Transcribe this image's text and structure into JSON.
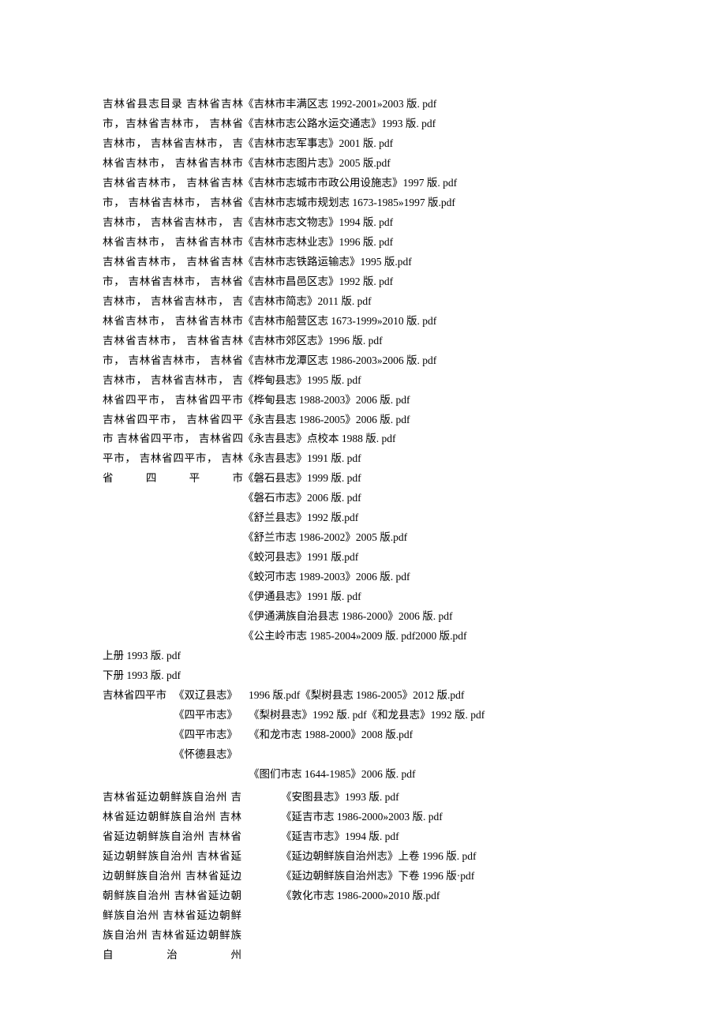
{
  "block1": {
    "left": "吉林省县志目录 吉林省吉林市，吉林省吉林市， 吉林省吉林市， 吉林省吉林市， 吉林省吉林市， 吉林省吉林市 吉林省吉林市， 吉林省吉林市， 吉林省吉林市， 吉林省吉林市， 吉林省吉林市， 吉林省吉林市， 吉林省吉林市 吉林省吉林市， 吉林省吉林市， 吉林省吉林市， 吉林省吉林市， 吉林省吉林市， 吉林省吉林市， 吉林省吉林市 吉林省吉林市， 吉林省吉林市， 吉林省吉林市， 吉林省吉林市， 吉林省吉林市， 吉林省四平市， 吉林省四平市 吉林省四平市， 吉林省四平市 吉林省四平市， 吉林省四平市， 吉林省四平市， 吉林省四平市",
    "right": [
      "《吉林市丰满区志 1992-2001»2003 版. pdf",
      "《吉林市志公路水运交通志》1993 版. pdf",
      "《吉林市志军事志》2001 版. pdf",
      "《吉林市志图片志》2005 版.pdf",
      "《吉林市志城市市政公用设施志》1997 版. pdf",
      "《吉林市志城市规划志 1673-1985»1997 版.pdf",
      "《吉林市志文物志》1994 版. pdf",
      "《吉林市志林业志》1996 版. pdf",
      "《吉林市志铁路运输志》1995 版.pdf",
      "《吉林市昌邑区志》1992 版. pdf",
      "《吉林市简志》2011 版. pdf",
      "《吉林市船营区志 1673-1999»2010 版. pdf",
      "《吉林市郊区志》1996 版. pdf",
      "《吉林市龙潭区志 1986-2003»2006 版. pdf",
      "《桦甸县志》1995 版. pdf",
      "《桦甸县志 1988-2003》2006 版. pdf",
      "《永吉县志 1986-2005》2006 版. pdf",
      "《永吉县志》点校本 1988 版. pdf",
      "《永吉县志》1991 版. pdf",
      "《磐石县志》1999 版. pdf",
      "《磐石市志》2006 版. pdf",
      "《舒兰县志》1992 版.pdf",
      "《舒兰市志 1986-2002》2005 版.pdf",
      "《蛟河县志》1991 版.pdf",
      "《蛟河市志 1989-2003》2006 版. pdf",
      "《伊通县志》1991 版. pdf",
      "《伊通满族自治县志 1986-2000》2006 版. pdf",
      "《公主岭市志 1985-2004»2009 版. pdf2000 版.pdf"
    ],
    "tail": [
      "上册 1993 版. pdf",
      "下册 1993 版. pdf"
    ]
  },
  "b2": {
    "left": "吉林省四平市",
    "mid": [
      "《双辽县志》",
      "《四平市志》",
      "《四平市志》",
      "《怀德县志》"
    ],
    "right": [
      "1996 版.pdf《梨树县志 1986-2005》2012 版.pdf",
      "《梨树县志》1992 版. pdf《和龙县志》1992 版. pdf",
      "《和龙市志 1988-2000》2008 版.pdf"
    ],
    "extra": "《图们市志 1644-1985》2006 版. pdf"
  },
  "b3": {
    "left": "吉林省延边朝鲜族自治州 吉林省延边朝鲜族自治州 吉林省延边朝鲜族自治州 吉林省延边朝鲜族自治州 吉林省延边朝鲜族自治州 吉林省延边朝鲜族自治州 吉林省延边朝鲜族自治州 吉林省延边朝鲜族自治州 吉林省延边朝鲜族自治州",
    "right": [
      "《安图县志》1993 版. pdf",
      "《延吉市志 1986-2000»2003 版. pdf",
      "《延吉市志》1994 版. pdf",
      "《延边朝鲜族自治州志》上卷 1996 版. pdf",
      "《延边朝鲜族自治州志》下卷 1996 版·pdf",
      "《敦化市志 1986-2000»2010 版.pdf"
    ]
  }
}
